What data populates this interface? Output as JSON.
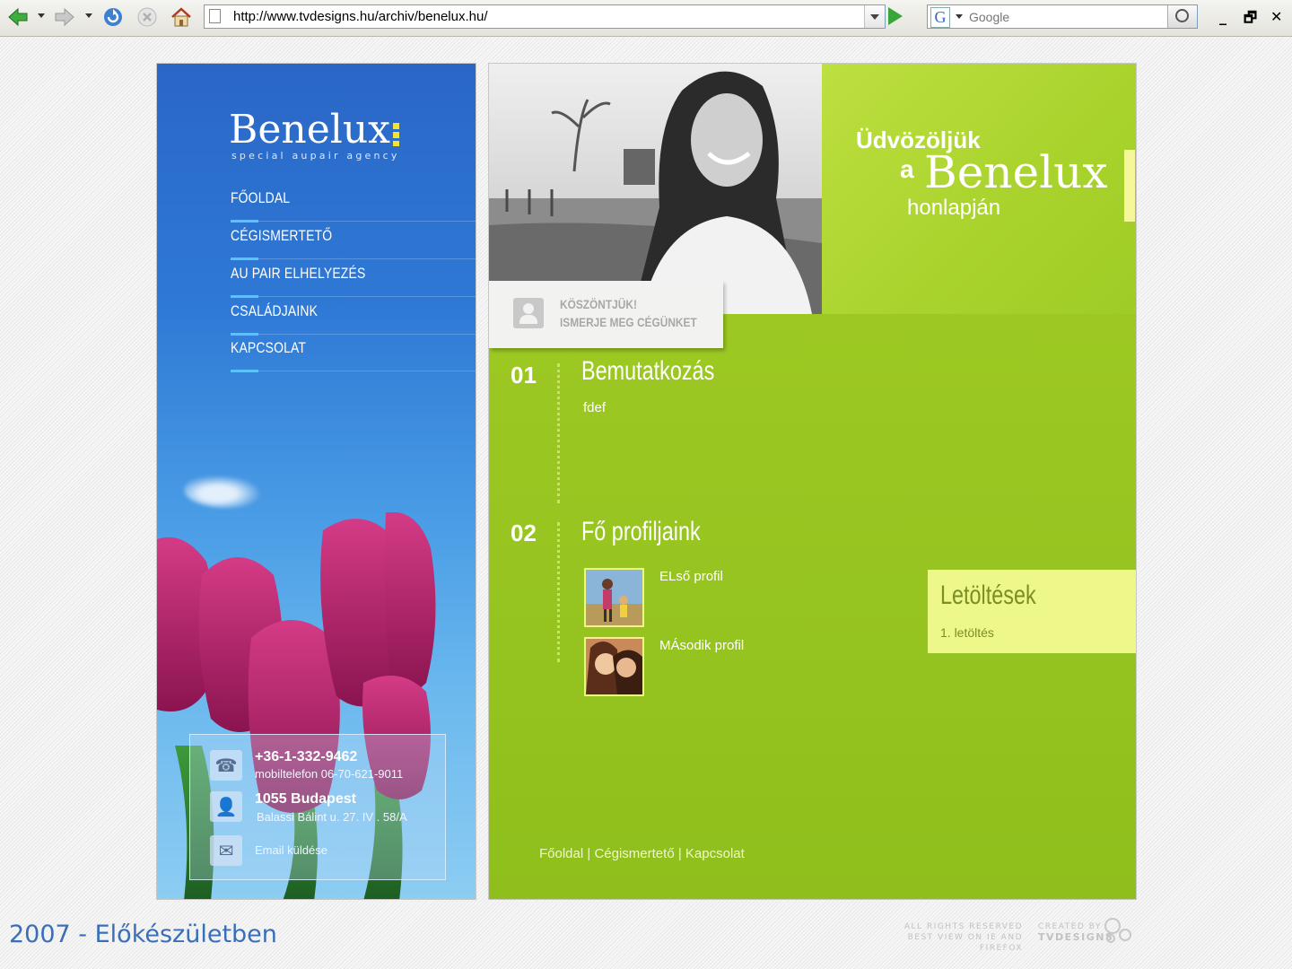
{
  "browser": {
    "url": "http://www.tvdesigns.hu/archiv/benelux.hu/",
    "search_placeholder": "Google",
    "search_engine_letter": "G",
    "window_controls": [
      "_",
      "🗗",
      "✕"
    ]
  },
  "site": {
    "logo": "Benelux",
    "tagline": "special aupair agency",
    "nav": [
      {
        "label": "FŐOLDAL"
      },
      {
        "label": "CÉGISMERTETŐ"
      },
      {
        "label": "AU PAIR ELHELYEZÉS"
      },
      {
        "label": "CSALÁDJAINK"
      },
      {
        "label": "KAPCSOLAT"
      }
    ],
    "contact": {
      "phone": "+36-1-332-9462",
      "mobile": "mobiltelefon 06-70-621-9011",
      "city": "1055 Budapest",
      "street": "Balassi Bálint u. 27. IV . 58/A",
      "email_label": "Email küldése"
    },
    "welcome": {
      "line1": "Üdvözöljük",
      "a": "a",
      "name": "Benelux",
      "line3": "honlapján"
    },
    "greeting": {
      "line1": "KÖSZÖNTJÜK!",
      "line2": "ISMERJE MEG CÉGÜNKET"
    },
    "sections": [
      {
        "num": "01",
        "title": "Bemutatkozás",
        "text": "fdef"
      },
      {
        "num": "02",
        "title": "Fő profiljaink"
      }
    ],
    "profiles": [
      {
        "label": "ELső profil"
      },
      {
        "label": "MÁsodik profil"
      }
    ],
    "downloads": {
      "title": "Letöltések",
      "item": "1. letöltés"
    },
    "footer_nav": [
      "Főoldal",
      "Cégismertető",
      "Kapcsolat"
    ],
    "footer_sep": "|"
  },
  "page": {
    "caption": "2007 - Előkészületben",
    "credits_line1": "ALL RIGHTS RESERVED",
    "credits_line2": "BEST VIEW ON IE AND FIREFOX",
    "created_by": "CREATED BY",
    "creator": "TVDESIGNS"
  },
  "colors": {
    "nav_accent": "#59c2ff",
    "green_bg": "#9bc722",
    "download_bg": "#eef78a",
    "caption_blue": "#3a6fb8"
  },
  "icons": [
    "back-arrow-icon",
    "forward-arrow-icon",
    "refresh-icon",
    "stop-icon",
    "home-icon",
    "page-icon",
    "go-icon",
    "search-icon",
    "phone-icon",
    "person-icon",
    "envelope-icon"
  ]
}
